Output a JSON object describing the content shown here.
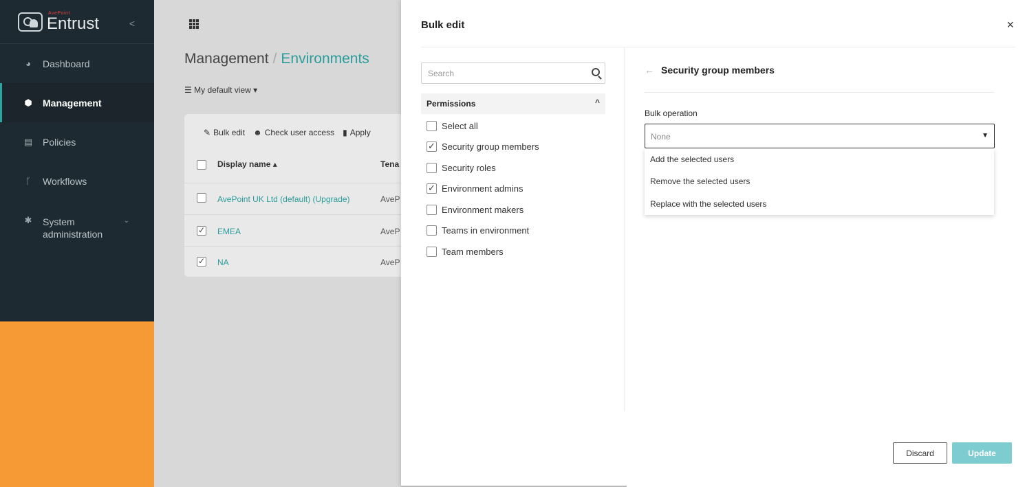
{
  "sidebar": {
    "logo_small": "AvePoint",
    "logo_big": "Entrust",
    "collapse": "<",
    "items": [
      {
        "label": "Dashboard",
        "icon": "pie-chart-icon"
      },
      {
        "label": "Management",
        "icon": "cube-icon"
      },
      {
        "label": "Policies",
        "icon": "policy-icon"
      },
      {
        "label": "Workflows",
        "icon": "workflow-icon"
      },
      {
        "label": "System administration",
        "icon": "gear-icon"
      }
    ]
  },
  "main": {
    "breadcrumb": {
      "parent": "Management",
      "separator": "/",
      "current": "Environments"
    },
    "view_select": "My default view",
    "toolbar": {
      "bulk_edit": "Bulk edit",
      "check_access": "Check user access",
      "apply": "Apply"
    },
    "table": {
      "headers": {
        "name": "Display name",
        "tenant": "Tena"
      },
      "rows": [
        {
          "name": "AvePoint UK Ltd (default) (Upgrade)",
          "tenant": "AveP",
          "checked": false
        },
        {
          "name": "EMEA",
          "tenant": "AveP",
          "checked": true
        },
        {
          "name": "NA",
          "tenant": "AveP",
          "checked": true
        }
      ]
    }
  },
  "panel": {
    "title": "Bulk edit",
    "close": "×",
    "search_placeholder": "Search",
    "permissions_header": "Permissions",
    "permissions": [
      {
        "label": "Select all",
        "checked": false
      },
      {
        "label": "Security group members",
        "checked": true
      },
      {
        "label": "Security roles",
        "checked": false
      },
      {
        "label": "Environment admins",
        "checked": true
      },
      {
        "label": "Environment makers",
        "checked": false
      },
      {
        "label": "Teams in environment",
        "checked": false
      },
      {
        "label": "Team members",
        "checked": false
      }
    ],
    "section_title": "Security group members",
    "bulk_operation_label": "Bulk operation",
    "bulk_operation_value": "None",
    "dropdown_options": [
      "Add the selected users",
      "Remove the selected users",
      "Replace with the selected users"
    ],
    "discard": "Discard",
    "update": "Update"
  },
  "colors": {
    "accent": "#2a9d9a",
    "sidebar_bg": "#1e2a31",
    "update_btn": "#7dcdd0",
    "orange": "#f59a34"
  }
}
